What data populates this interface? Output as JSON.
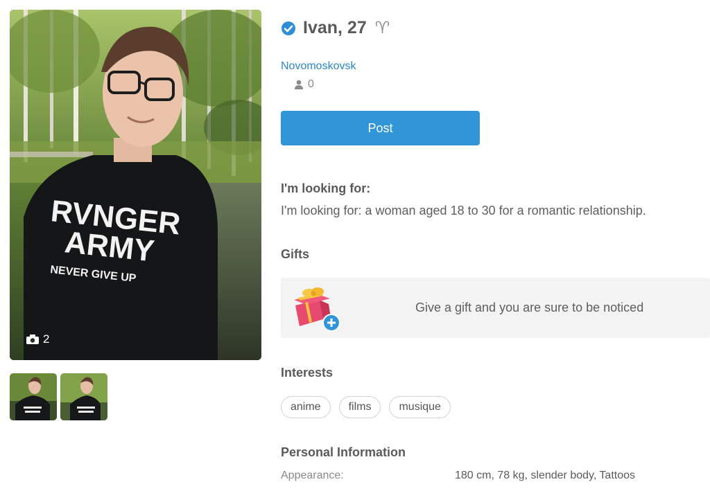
{
  "profile": {
    "name_age": "Ivan, 27",
    "zodiac_symbol": "♈",
    "city": "Novomoskovsk",
    "friends_count": "0",
    "photo_count": "2"
  },
  "actions": {
    "post_label": "Post"
  },
  "looking_for": {
    "title": "I'm looking for:",
    "text": "I'm looking for: a woman aged 18 to 30 for a romantic relationship."
  },
  "gifts": {
    "title": "Gifts",
    "prompt": "Give a gift and you are sure to be noticed"
  },
  "interests": {
    "title": "Interests",
    "items": [
      "anime",
      "films",
      "musique"
    ]
  },
  "personal_info": {
    "title": "Personal Information",
    "appearance_label": "Appearance:",
    "appearance_value": "180 cm, 78 kg, slender body, Tattoos"
  },
  "shirt_text": {
    "line1": "RVNGER",
    "line2": "ARMY",
    "line3": "NEVER GIVE UP"
  },
  "colors": {
    "accent": "#3196d8",
    "link": "#2a87c7",
    "verified": "#2f8fd6"
  },
  "icons": {
    "verified": "check-circle-icon",
    "camera": "camera-icon",
    "person": "person-icon",
    "gift": "gift-icon",
    "plus": "plus-circle-icon"
  }
}
